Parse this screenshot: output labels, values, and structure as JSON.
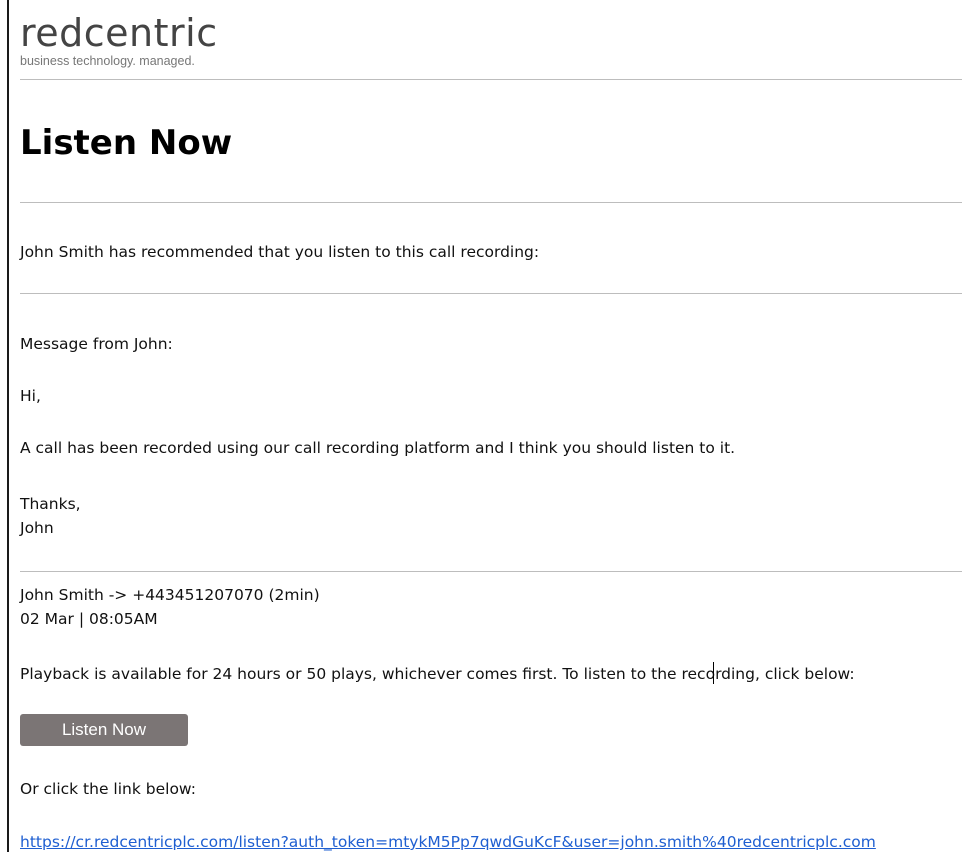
{
  "brand": {
    "name": "redcentric",
    "tagline": "business technology. managed."
  },
  "title": "Listen Now",
  "intro": "John Smith has recommended that you listen to this call recording:",
  "message": {
    "header": "Message from John:",
    "greeting": "Hi,",
    "body": "A call has been recorded using our call recording platform and I think you should listen to it.",
    "signoff": "Thanks,",
    "signature": "John"
  },
  "call": {
    "summary": "John Smith -> +443451207070 (2min)",
    "datetime": "02 Mar | 08:05AM"
  },
  "playback_note": "Playback is available for 24 hours or 50 plays, whichever comes first. To listen to the recording, click below:",
  "button_label": "Listen Now",
  "link_intro": "Or click the link below:",
  "link_url": "https://cr.redcentricplc.com/listen?auth_token=mtykM5Pp7qwdGuKcF&user=john.smith%40redcentricplc.com"
}
